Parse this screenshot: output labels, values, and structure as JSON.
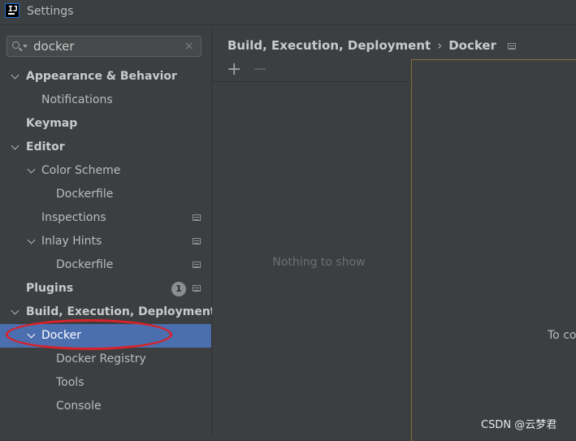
{
  "window": {
    "title": "Settings",
    "logo_text": "IJ"
  },
  "search": {
    "value": "docker",
    "clear_glyph": "✕"
  },
  "tree": [
    {
      "label": "Appearance & Behavior",
      "bold": true,
      "expanded": true
    },
    {
      "label": "Notifications"
    },
    {
      "label": "Keymap",
      "bold": true
    },
    {
      "label": "Editor",
      "bold": true,
      "expanded": true
    },
    {
      "label": "Color Scheme",
      "expanded": true
    },
    {
      "label": "Dockerfile"
    },
    {
      "label": "Inspections",
      "project_icon": true
    },
    {
      "label": "Inlay Hints",
      "expanded": true,
      "project_icon": true
    },
    {
      "label": "Dockerfile",
      "project_icon": true
    },
    {
      "label": "Plugins",
      "bold": true,
      "badge": "1",
      "project_icon": true
    },
    {
      "label": "Build, Execution, Deployment",
      "bold": true,
      "expanded": true
    },
    {
      "label": "Docker",
      "expanded": true,
      "selected": true
    },
    {
      "label": "Docker Registry"
    },
    {
      "label": "Tools"
    },
    {
      "label": "Console"
    }
  ],
  "breadcrumb": {
    "parent": "Build, Execution, Deployment",
    "separator": "›",
    "current": "Docker"
  },
  "list_panel": {
    "add_glyph": "+",
    "remove_glyph": "−",
    "empty_text": "Nothing to show"
  },
  "detail_panel": {
    "partial_text": "To co"
  },
  "watermark": "CSDN @云梦君",
  "colors": {
    "selection": "#4b6eaf",
    "highlight_ellipse": "#d8222a",
    "background": "#3c3f41"
  }
}
